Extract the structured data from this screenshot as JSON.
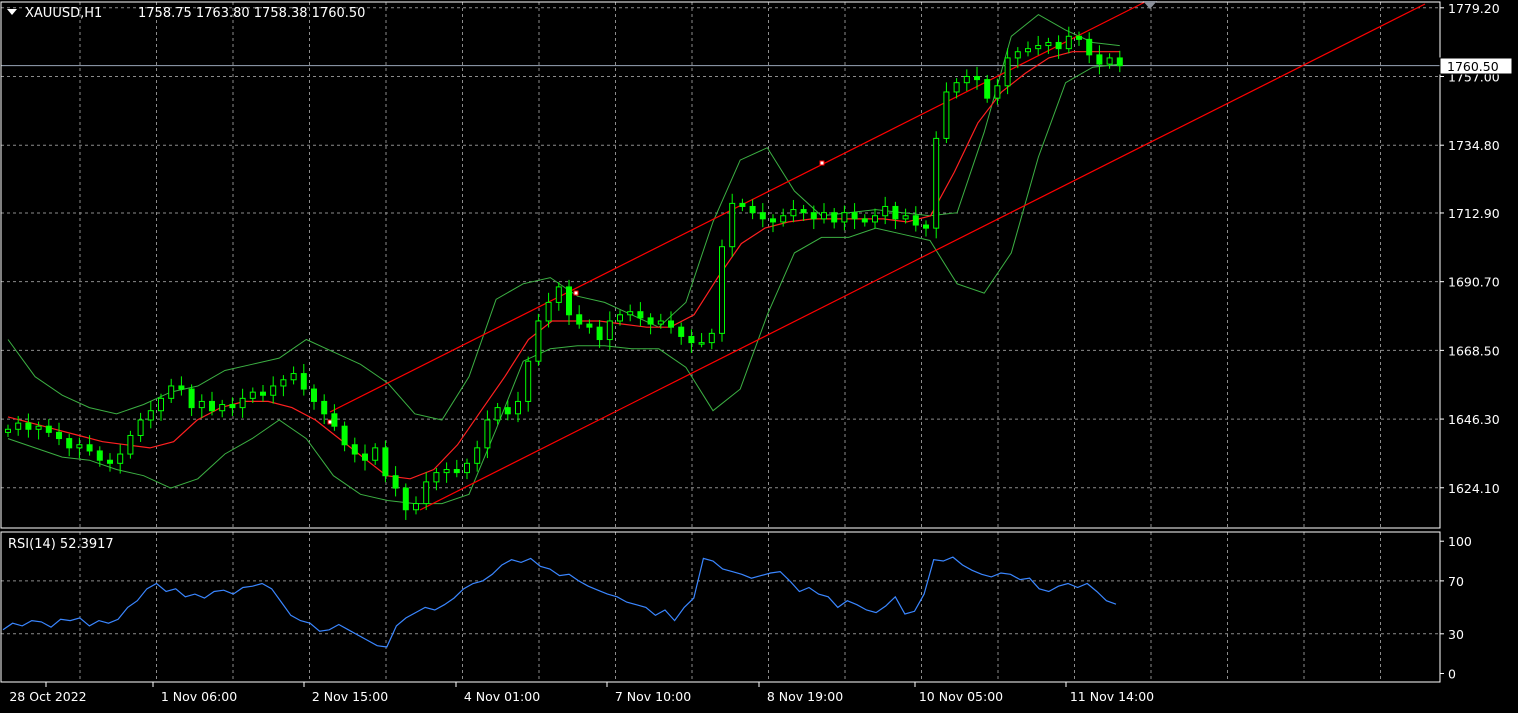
{
  "colors": {
    "background": "#000000",
    "grid": "#8c8c8c",
    "frame": "#ffffff",
    "text": "#ffffff",
    "candle": "#00ff00",
    "bollinger": "#3cb043",
    "ma": "#ff2020",
    "channel": "#ff0000",
    "rsi": "#3a86ff",
    "price_line": "#9aa6b8"
  },
  "main_panel": {
    "symbol": "XAUUSD,H1",
    "ohlc": "1758.75 1763.80 1758.38 1760.50",
    "current_price": "1760.50",
    "current_price_value": 1760.5
  },
  "rsi_panel": {
    "label": "RSI(14) 52.3917"
  },
  "chart_data": [
    {
      "type": "candlestick",
      "title": "XAUUSD,H1",
      "y_ticks": [
        "1779.20",
        "1757.00",
        "1734.80",
        "1712.90",
        "1690.70",
        "1668.50",
        "1646.30",
        "1624.10"
      ],
      "y_tick_values": [
        1779.2,
        1757.0,
        1734.8,
        1712.9,
        1690.7,
        1668.5,
        1646.3,
        1624.1
      ],
      "ylim": [
        1608.0,
        1780.0
      ],
      "x_ticks": [
        "28 Oct 2022",
        "1 Nov 06:00",
        "2 Nov 15:00",
        "4 Nov 01:00",
        "7 Nov 10:00",
        "8 Nov 19:00",
        "10 Nov 05:00",
        "11 Nov 14:00"
      ],
      "grid": true,
      "series": [
        {
          "kind": "close",
          "values": [
            1643,
            1645,
            1643,
            1644,
            1642,
            1640,
            1637,
            1638,
            1636,
            1633,
            1632,
            1635,
            1641,
            1646,
            1649,
            1653,
            1657,
            1656,
            1650,
            1652,
            1649,
            1651,
            1650,
            1653,
            1655,
            1654,
            1657,
            1659,
            1661,
            1656,
            1652,
            1648,
            1644,
            1638,
            1635,
            1633,
            1637,
            1628,
            1624,
            1617,
            1619,
            1626,
            1629,
            1630,
            1629,
            1632,
            1637,
            1646,
            1650,
            1648,
            1652,
            1665,
            1678,
            1684,
            1689,
            1680,
            1677,
            1676,
            1672,
            1678,
            1680,
            1681,
            1679,
            1677,
            1678,
            1676,
            1673,
            1671,
            1671,
            1674,
            1702,
            1716,
            1715,
            1713,
            1711,
            1710,
            1712,
            1714,
            1713,
            1711,
            1713,
            1710,
            1713,
            1711,
            1710,
            1712,
            1715,
            1711,
            1712,
            1709,
            1708,
            1737,
            1752,
            1755,
            1757,
            1756,
            1750,
            1754,
            1763,
            1765,
            1766,
            1767,
            1768,
            1766,
            1770,
            1769,
            1764,
            1761,
            1763,
            1760.5
          ]
        },
        {
          "kind": "ma20",
          "values": [
            1647,
            1645,
            1643,
            1641,
            1639,
            1638,
            1637,
            1639,
            1646,
            1650,
            1652,
            1652,
            1650,
            1646,
            1640,
            1634,
            1628,
            1627,
            1630,
            1638,
            1649,
            1660,
            1672,
            1678,
            1678,
            1678,
            1677,
            1676,
            1676,
            1680,
            1692,
            1703,
            1708,
            1710,
            1711,
            1711,
            1711,
            1711,
            1710,
            1712,
            1726,
            1742,
            1752,
            1758,
            1763,
            1765,
            1765,
            1765
          ]
        },
        {
          "kind": "bb_upper",
          "values": [
            1672,
            1660,
            1654,
            1650,
            1648,
            1651,
            1655,
            1657,
            1662,
            1664,
            1666,
            1672,
            1668,
            1664,
            1658,
            1648,
            1646,
            1660,
            1685,
            1690,
            1692,
            1686,
            1684,
            1680,
            1676,
            1684,
            1710,
            1730,
            1734,
            1720,
            1712,
            1713,
            1714,
            1713,
            1712,
            1713,
            1739,
            1770,
            1777,
            1772,
            1768,
            1767
          ]
        },
        {
          "kind": "bb_lower",
          "values": [
            1640,
            1637,
            1634,
            1633,
            1630,
            1628,
            1624,
            1627,
            1635,
            1640,
            1646,
            1640,
            1628,
            1622,
            1620,
            1619,
            1619,
            1622,
            1643,
            1665,
            1669,
            1670,
            1670,
            1669,
            1669,
            1663,
            1649,
            1656,
            1680,
            1700,
            1705,
            1705,
            1708,
            1706,
            1704,
            1690,
            1687,
            1700,
            1731,
            1755,
            1760,
            1761
          ]
        },
        {
          "kind": "trend_channel",
          "values": [
            "upper",
            "lower"
          ]
        }
      ]
    },
    {
      "type": "line",
      "title": "RSI(14) 52.3917",
      "y_ticks": [
        "100",
        "70",
        "30",
        "0"
      ],
      "y_tick_values": [
        100,
        70,
        30,
        0
      ],
      "ylim": [
        0,
        100
      ],
      "levels": [
        70,
        30
      ],
      "grid": true,
      "series": [
        {
          "name": "RSI(14)",
          "values": [
            33,
            38,
            36,
            40,
            39,
            35,
            41,
            40,
            42,
            36,
            40,
            38,
            41,
            50,
            55,
            64,
            68,
            62,
            64,
            58,
            60,
            57,
            62,
            63,
            60,
            65,
            66,
            68,
            64,
            54,
            44,
            40,
            38,
            32,
            33,
            37,
            33,
            29,
            25,
            21,
            20,
            36,
            42,
            46,
            50,
            48,
            52,
            57,
            64,
            68,
            70,
            75,
            82,
            86,
            84,
            87,
            81,
            79,
            74,
            75,
            70,
            66,
            63,
            60,
            58,
            54,
            52,
            50,
            44,
            48,
            40,
            50,
            57,
            87,
            85,
            79,
            77,
            75,
            72,
            74,
            76,
            77,
            70,
            62,
            65,
            60,
            58,
            50,
            55,
            52,
            48,
            46,
            51,
            58,
            45,
            47,
            60,
            86,
            85,
            88,
            82,
            78,
            75,
            73,
            76,
            75,
            71,
            72,
            64,
            62,
            66,
            68,
            65,
            68,
            62,
            55,
            52.39
          ]
        }
      ]
    }
  ]
}
